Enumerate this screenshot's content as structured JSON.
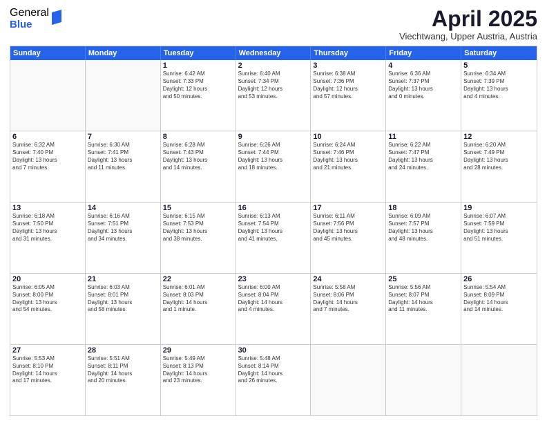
{
  "logo": {
    "general": "General",
    "blue": "Blue"
  },
  "header": {
    "month": "April 2025",
    "location": "Viechtwang, Upper Austria, Austria"
  },
  "weekdays": [
    "Sunday",
    "Monday",
    "Tuesday",
    "Wednesday",
    "Thursday",
    "Friday",
    "Saturday"
  ],
  "rows": [
    [
      {
        "day": "",
        "lines": []
      },
      {
        "day": "",
        "lines": []
      },
      {
        "day": "1",
        "lines": [
          "Sunrise: 6:42 AM",
          "Sunset: 7:33 PM",
          "Daylight: 12 hours",
          "and 50 minutes."
        ]
      },
      {
        "day": "2",
        "lines": [
          "Sunrise: 6:40 AM",
          "Sunset: 7:34 PM",
          "Daylight: 12 hours",
          "and 53 minutes."
        ]
      },
      {
        "day": "3",
        "lines": [
          "Sunrise: 6:38 AM",
          "Sunset: 7:36 PM",
          "Daylight: 12 hours",
          "and 57 minutes."
        ]
      },
      {
        "day": "4",
        "lines": [
          "Sunrise: 6:36 AM",
          "Sunset: 7:37 PM",
          "Daylight: 13 hours",
          "and 0 minutes."
        ]
      },
      {
        "day": "5",
        "lines": [
          "Sunrise: 6:34 AM",
          "Sunset: 7:39 PM",
          "Daylight: 13 hours",
          "and 4 minutes."
        ]
      }
    ],
    [
      {
        "day": "6",
        "lines": [
          "Sunrise: 6:32 AM",
          "Sunset: 7:40 PM",
          "Daylight: 13 hours",
          "and 7 minutes."
        ]
      },
      {
        "day": "7",
        "lines": [
          "Sunrise: 6:30 AM",
          "Sunset: 7:41 PM",
          "Daylight: 13 hours",
          "and 11 minutes."
        ]
      },
      {
        "day": "8",
        "lines": [
          "Sunrise: 6:28 AM",
          "Sunset: 7:43 PM",
          "Daylight: 13 hours",
          "and 14 minutes."
        ]
      },
      {
        "day": "9",
        "lines": [
          "Sunrise: 6:26 AM",
          "Sunset: 7:44 PM",
          "Daylight: 13 hours",
          "and 18 minutes."
        ]
      },
      {
        "day": "10",
        "lines": [
          "Sunrise: 6:24 AM",
          "Sunset: 7:46 PM",
          "Daylight: 13 hours",
          "and 21 minutes."
        ]
      },
      {
        "day": "11",
        "lines": [
          "Sunrise: 6:22 AM",
          "Sunset: 7:47 PM",
          "Daylight: 13 hours",
          "and 24 minutes."
        ]
      },
      {
        "day": "12",
        "lines": [
          "Sunrise: 6:20 AM",
          "Sunset: 7:49 PM",
          "Daylight: 13 hours",
          "and 28 minutes."
        ]
      }
    ],
    [
      {
        "day": "13",
        "lines": [
          "Sunrise: 6:18 AM",
          "Sunset: 7:50 PM",
          "Daylight: 13 hours",
          "and 31 minutes."
        ]
      },
      {
        "day": "14",
        "lines": [
          "Sunrise: 6:16 AM",
          "Sunset: 7:51 PM",
          "Daylight: 13 hours",
          "and 34 minutes."
        ]
      },
      {
        "day": "15",
        "lines": [
          "Sunrise: 6:15 AM",
          "Sunset: 7:53 PM",
          "Daylight: 13 hours",
          "and 38 minutes."
        ]
      },
      {
        "day": "16",
        "lines": [
          "Sunrise: 6:13 AM",
          "Sunset: 7:54 PM",
          "Daylight: 13 hours",
          "and 41 minutes."
        ]
      },
      {
        "day": "17",
        "lines": [
          "Sunrise: 6:11 AM",
          "Sunset: 7:56 PM",
          "Daylight: 13 hours",
          "and 45 minutes."
        ]
      },
      {
        "day": "18",
        "lines": [
          "Sunrise: 6:09 AM",
          "Sunset: 7:57 PM",
          "Daylight: 13 hours",
          "and 48 minutes."
        ]
      },
      {
        "day": "19",
        "lines": [
          "Sunrise: 6:07 AM",
          "Sunset: 7:59 PM",
          "Daylight: 13 hours",
          "and 51 minutes."
        ]
      }
    ],
    [
      {
        "day": "20",
        "lines": [
          "Sunrise: 6:05 AM",
          "Sunset: 8:00 PM",
          "Daylight: 13 hours",
          "and 54 minutes."
        ]
      },
      {
        "day": "21",
        "lines": [
          "Sunrise: 6:03 AM",
          "Sunset: 8:01 PM",
          "Daylight: 13 hours",
          "and 58 minutes."
        ]
      },
      {
        "day": "22",
        "lines": [
          "Sunrise: 6:01 AM",
          "Sunset: 8:03 PM",
          "Daylight: 14 hours",
          "and 1 minute."
        ]
      },
      {
        "day": "23",
        "lines": [
          "Sunrise: 6:00 AM",
          "Sunset: 8:04 PM",
          "Daylight: 14 hours",
          "and 4 minutes."
        ]
      },
      {
        "day": "24",
        "lines": [
          "Sunrise: 5:58 AM",
          "Sunset: 8:06 PM",
          "Daylight: 14 hours",
          "and 7 minutes."
        ]
      },
      {
        "day": "25",
        "lines": [
          "Sunrise: 5:56 AM",
          "Sunset: 8:07 PM",
          "Daylight: 14 hours",
          "and 11 minutes."
        ]
      },
      {
        "day": "26",
        "lines": [
          "Sunrise: 5:54 AM",
          "Sunset: 8:09 PM",
          "Daylight: 14 hours",
          "and 14 minutes."
        ]
      }
    ],
    [
      {
        "day": "27",
        "lines": [
          "Sunrise: 5:53 AM",
          "Sunset: 8:10 PM",
          "Daylight: 14 hours",
          "and 17 minutes."
        ]
      },
      {
        "day": "28",
        "lines": [
          "Sunrise: 5:51 AM",
          "Sunset: 8:11 PM",
          "Daylight: 14 hours",
          "and 20 minutes."
        ]
      },
      {
        "day": "29",
        "lines": [
          "Sunrise: 5:49 AM",
          "Sunset: 8:13 PM",
          "Daylight: 14 hours",
          "and 23 minutes."
        ]
      },
      {
        "day": "30",
        "lines": [
          "Sunrise: 5:48 AM",
          "Sunset: 8:14 PM",
          "Daylight: 14 hours",
          "and 26 minutes."
        ]
      },
      {
        "day": "",
        "lines": []
      },
      {
        "day": "",
        "lines": []
      },
      {
        "day": "",
        "lines": []
      }
    ]
  ]
}
